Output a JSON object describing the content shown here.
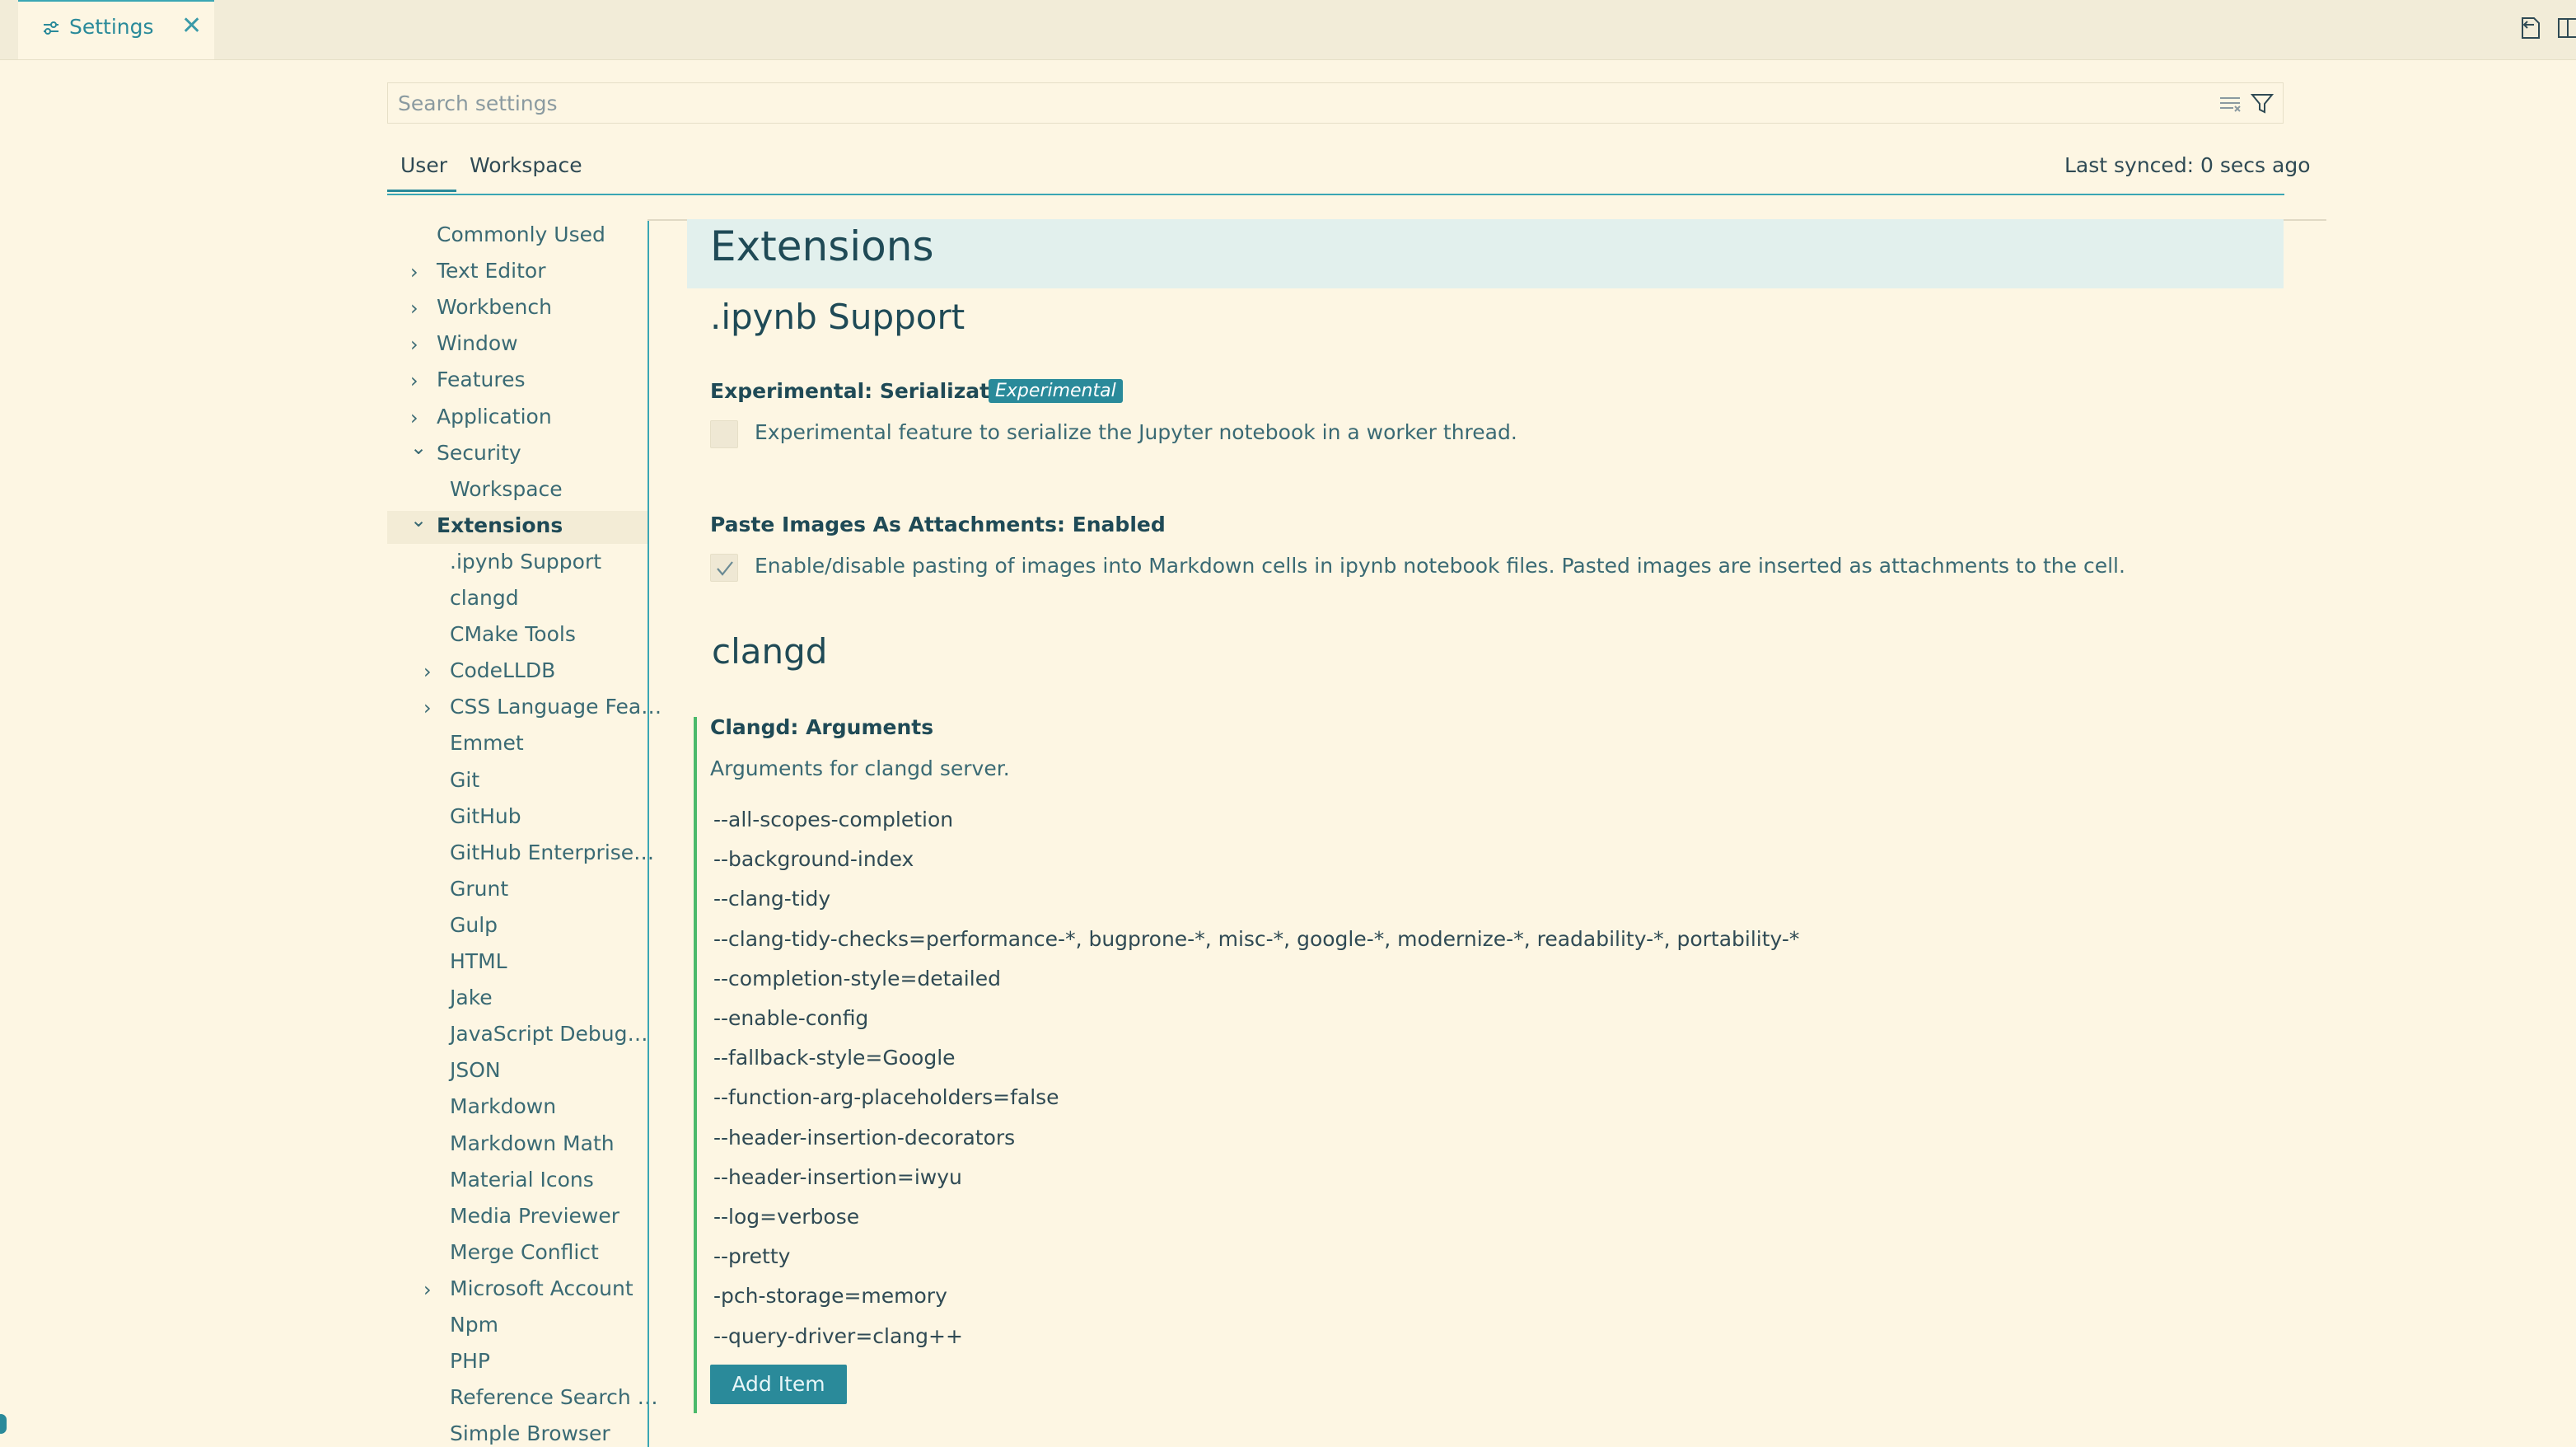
{
  "tab": {
    "label": "Settings"
  },
  "search": {
    "placeholder": "Search settings"
  },
  "scope": {
    "user": "User",
    "workspace": "Workspace",
    "synced": "Last synced: 0 secs ago"
  },
  "toc": {
    "items": [
      {
        "label": "Commonly Used",
        "chevron": ""
      },
      {
        "label": "Text Editor",
        "chevron": "right"
      },
      {
        "label": "Workbench",
        "chevron": "right"
      },
      {
        "label": "Window",
        "chevron": "right"
      },
      {
        "label": "Features",
        "chevron": "right"
      },
      {
        "label": "Application",
        "chevron": "right"
      },
      {
        "label": "Security",
        "chevron": "down"
      },
      {
        "label": "Workspace",
        "chevron": ""
      },
      {
        "label": "Extensions",
        "chevron": "down"
      },
      {
        "label": ".ipynb Support",
        "chevron": ""
      },
      {
        "label": "clangd",
        "chevron": ""
      },
      {
        "label": "CMake Tools",
        "chevron": ""
      },
      {
        "label": "CodeLLDB",
        "chevron": "right"
      },
      {
        "label": "CSS Language Fea…",
        "chevron": "right"
      },
      {
        "label": "Emmet",
        "chevron": ""
      },
      {
        "label": "Git",
        "chevron": ""
      },
      {
        "label": "GitHub",
        "chevron": ""
      },
      {
        "label": "GitHub Enterprise…",
        "chevron": ""
      },
      {
        "label": "Grunt",
        "chevron": ""
      },
      {
        "label": "Gulp",
        "chevron": ""
      },
      {
        "label": "HTML",
        "chevron": ""
      },
      {
        "label": "Jake",
        "chevron": ""
      },
      {
        "label": "JavaScript Debug…",
        "chevron": ""
      },
      {
        "label": "JSON",
        "chevron": ""
      },
      {
        "label": "Markdown",
        "chevron": ""
      },
      {
        "label": "Markdown Math",
        "chevron": ""
      },
      {
        "label": "Material Icons",
        "chevron": ""
      },
      {
        "label": "Media Previewer",
        "chevron": ""
      },
      {
        "label": "Merge Conflict",
        "chevron": ""
      },
      {
        "label": "Microsoft Account",
        "chevron": "right"
      },
      {
        "label": "Npm",
        "chevron": ""
      },
      {
        "label": "PHP",
        "chevron": ""
      },
      {
        "label": "Reference Search …",
        "chevron": ""
      },
      {
        "label": "Simple Browser",
        "chevron": ""
      }
    ]
  },
  "content": {
    "header": "Extensions",
    "ipynb": {
      "title": ".ipynb Support",
      "serialization": {
        "title": "Experimental: Serialization",
        "badge": "Experimental",
        "description": "Experimental feature to serialize the Jupyter notebook in a worker thread.",
        "checked": false
      },
      "paste": {
        "title": "Paste Images As Attachments: Enabled",
        "description": "Enable/disable pasting of images into Markdown cells in ipynb notebook files. Pasted images are inserted as attachments to the cell.",
        "checked": true
      }
    },
    "clangd": {
      "title": "clangd",
      "arguments": {
        "title": "Clangd: Arguments",
        "description": "Arguments for clangd server.",
        "items": [
          "--all-scopes-completion",
          "--background-index",
          "--clang-tidy",
          "--clang-tidy-checks=performance-*, bugprone-*, misc-*, google-*, modernize-*, readability-*, portability-*",
          "--completion-style=detailed",
          "--enable-config",
          "--fallback-style=Google",
          "--function-arg-placeholders=false",
          "--header-insertion-decorators",
          "--header-insertion=iwyu",
          "--log=verbose",
          "--pretty",
          "-pch-storage=memory",
          "--query-driver=clang++"
        ],
        "add_label": "Add Item"
      }
    }
  },
  "icons": {
    "settings": "settings-sliders-icon",
    "close": "close-icon",
    "open_json": "open-settings-json-icon",
    "split": "split-editor-icon",
    "clear": "clear-filter-icon",
    "filter": "filter-icon"
  }
}
